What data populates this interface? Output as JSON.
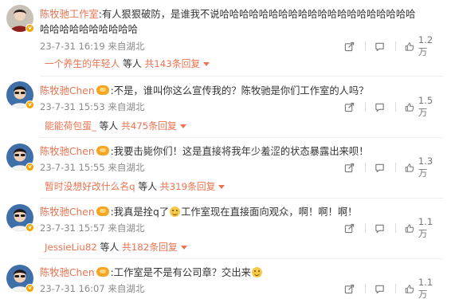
{
  "comments": [
    {
      "username": "陈牧驰工作室",
      "has_fan_badge": false,
      "text": ":有人狠狠破防，是谁我不说哈哈哈哈哈哈哈哈哈哈哈哈哈哈哈哈哈哈哈哈",
      "text_cont": "哈哈哈哈哈哈哈哈哈哈",
      "time": "23-7-31 16:19",
      "location": "来自湖北",
      "likes": "1.2万",
      "reply_user": "一个养生的年轻人",
      "reply_mid": " 等人 ",
      "reply_link": "共143条回复",
      "badge_label": "v"
    },
    {
      "username": "陈牧驰Chen",
      "has_fan_badge": true,
      "text": ":不是，谁叫你这么宣传我的？陈牧驰是你们工作室的人吗？",
      "time": "23-7-31 15:53",
      "location": "来自湖北",
      "likes": "1.5万",
      "reply_user": "能能荷包蛋_",
      "reply_mid": " 等人 ",
      "reply_link": "共475条回复",
      "badge_label": "v"
    },
    {
      "username": "陈牧驰Chen",
      "has_fan_badge": true,
      "text": ":我要击毙你们！这是直接将我年少羞涩的状态暴露出来呗！",
      "time": "23-7-31 15:55",
      "location": "来自湖北",
      "likes": "1.3万",
      "reply_user": "暂时没想好改什么名q",
      "reply_mid": " 等人 ",
      "reply_link": "共319条回复",
      "badge_label": "v"
    },
    {
      "username": "陈牧驰Chen",
      "has_fan_badge": true,
      "text_a": ":我真是拴q了",
      "text_b": "工作室现在直接面向观众，啊！啊！啊！",
      "time": "23-7-31 15:57",
      "location": "来自湖北",
      "likes": "1.1万",
      "reply_user": "JessieLiu82",
      "reply_mid": " 等人 ",
      "reply_link": "共182条回复",
      "badge_label": "v"
    },
    {
      "username": "陈牧驰Chen",
      "has_fan_badge": true,
      "text": ":工作室是不是有公司章？交出来",
      "time": "23-7-31 16:07",
      "location": "来自湖北",
      "likes": "1.1万",
      "badge_label": "v"
    }
  ],
  "icons": {
    "share": "share-icon",
    "comment": "comment-icon",
    "like": "thumbs-up-icon"
  },
  "colors": {
    "username": "#eb7350",
    "meta": "#8a8a8a",
    "link": "#eb7350"
  }
}
